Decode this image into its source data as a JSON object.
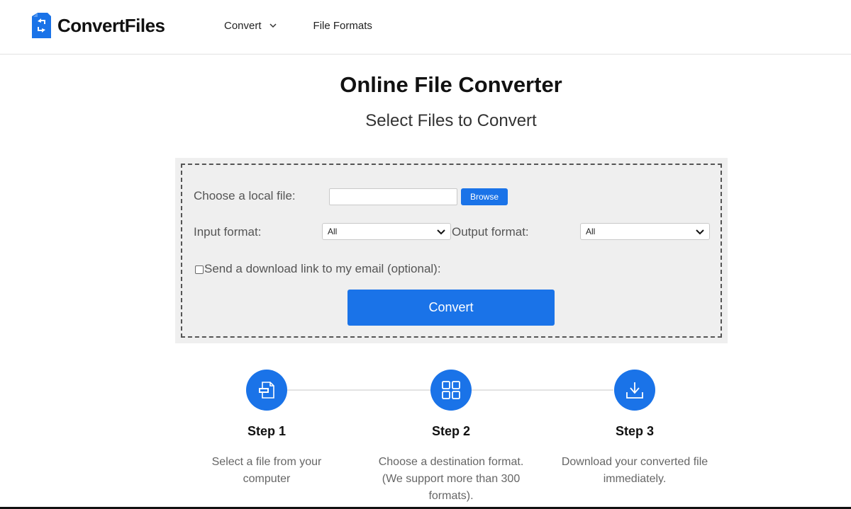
{
  "brand": {
    "name": "ConvertFiles"
  },
  "nav": {
    "convert_label": "Convert",
    "formats_label": "File Formats"
  },
  "main": {
    "title": "Online File Converter",
    "subtitle": "Select Files to Convert"
  },
  "form": {
    "choose_label": "Choose a local file:",
    "file_value": "",
    "browse_label": "Browse",
    "input_format_label": "Input format:",
    "input_format_value": "All",
    "output_format_label": "Output format:",
    "output_format_value": "All",
    "email_checkbox_label": "Send a download link to my email (optional):",
    "email_checked": false,
    "convert_label": "Convert"
  },
  "steps": [
    {
      "title": "Step 1",
      "line1": "Select a file from your",
      "line2": "computer",
      "line3": "",
      "icon": "file-icon"
    },
    {
      "title": "Step 2",
      "line1": "Choose a destination format.",
      "line2": "(We support more than 300",
      "line3": "formats).",
      "icon": "grid-icon"
    },
    {
      "title": "Step 3",
      "line1": "Download your converted file",
      "line2": "immediately.",
      "line3": "",
      "icon": "download-icon"
    }
  ],
  "colors": {
    "accent": "#1a73e8",
    "panel_bg": "#efefef",
    "text": "#222222",
    "muted": "#666666"
  }
}
